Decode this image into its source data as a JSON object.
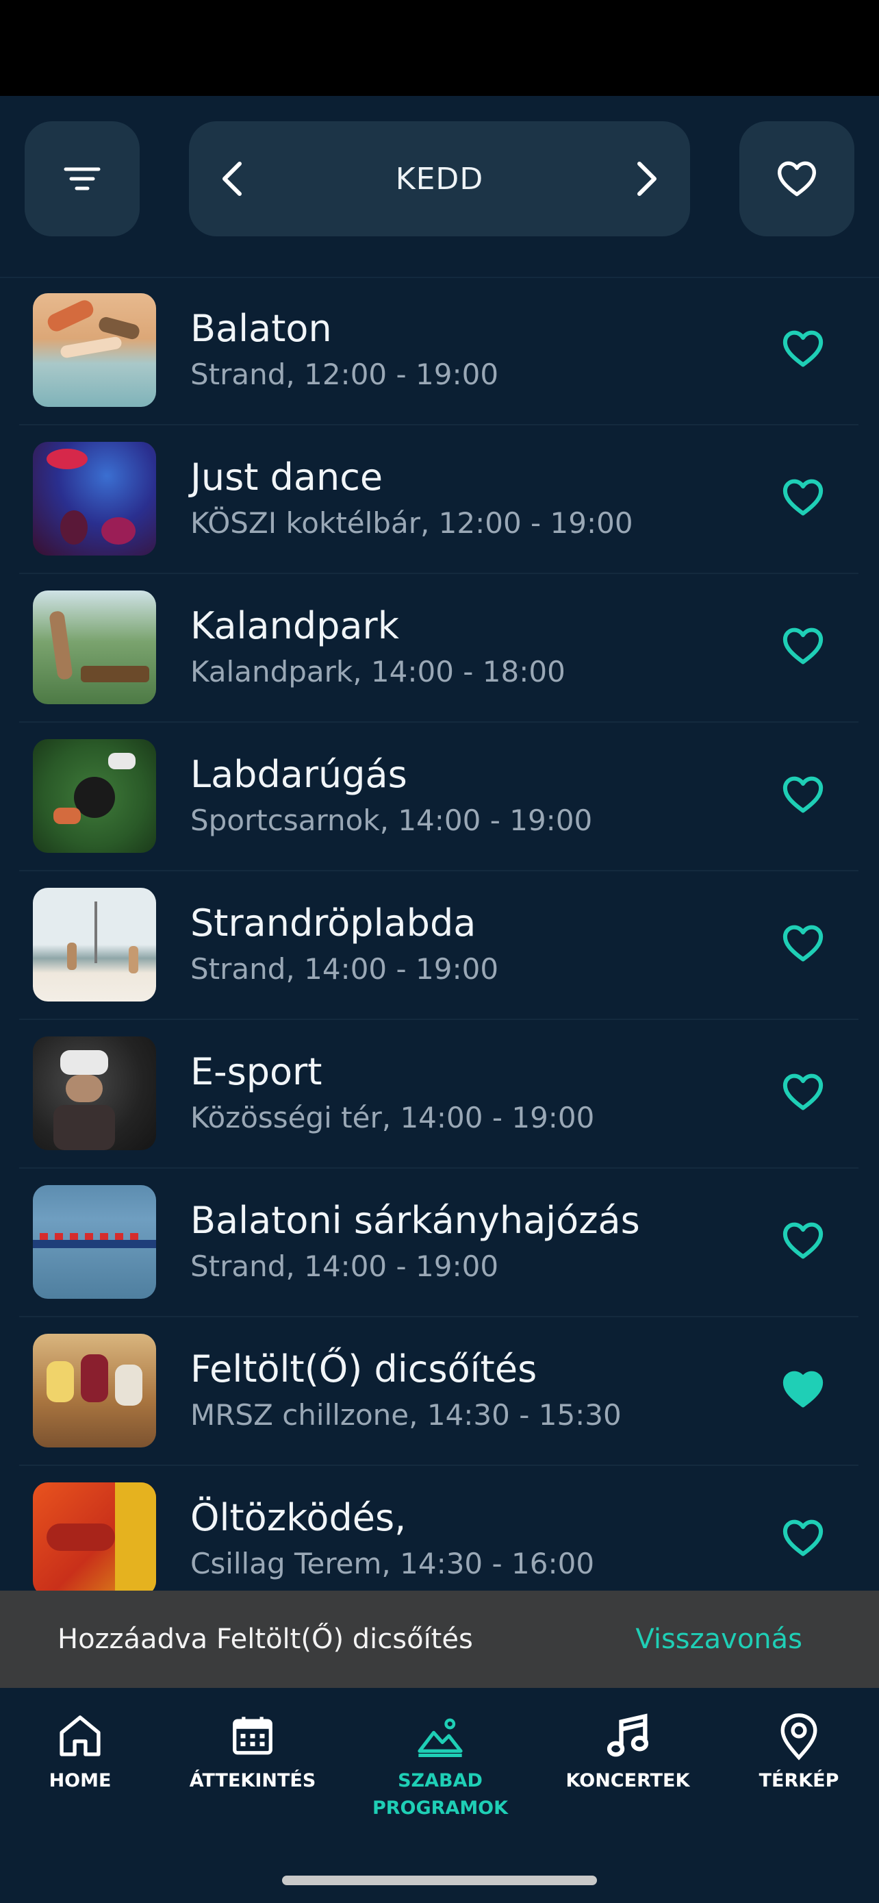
{
  "header": {
    "day": "KEDD",
    "filter_icon": "filter-icon",
    "prev_icon": "chevron-left-icon",
    "next_icon": "chevron-right-icon",
    "favorites_icon": "heart-outline-icon"
  },
  "events": [
    {
      "title": "Balaton",
      "subtitle": "Strand, 12:00 - 19:00",
      "favorite": false
    },
    {
      "title": "Just dance",
      "subtitle": "KÖSZI koktélbár, 12:00 - 19:00",
      "favorite": false
    },
    {
      "title": "Kalandpark",
      "subtitle": "Kalandpark, 14:00 - 18:00",
      "favorite": false
    },
    {
      "title": "Labdarúgás",
      "subtitle": "Sportcsarnok, 14:00 - 19:00",
      "favorite": false
    },
    {
      "title": "Strandröplabda",
      "subtitle": "Strand, 14:00 - 19:00",
      "favorite": false
    },
    {
      "title": "E-sport",
      "subtitle": "Közösségi tér, 14:00 - 19:00",
      "favorite": false
    },
    {
      "title": "Balatoni sárkányhajózás",
      "subtitle": "Strand, 14:00 - 19:00",
      "favorite": false
    },
    {
      "title": "Feltölt(Ő) dicsőítés",
      "subtitle": "MRSZ chillzone, 14:30 - 15:30",
      "favorite": true
    },
    {
      "title": "Öltözködés,",
      "subtitle": "Csillag Terem, 14:30 - 16:00",
      "favorite": false
    }
  ],
  "snackbar": {
    "message": "Hozzáadva Feltölt(Ő) dicsőítés",
    "action": "Visszavonás"
  },
  "tabs": [
    {
      "label": "HOME",
      "icon": "home-icon",
      "active": false
    },
    {
      "label": "ÁTTEKINTÉS",
      "icon": "calendar-icon",
      "active": false
    },
    {
      "label": "SZABAD\nPROGRAMOK",
      "icon": "mountain-icon",
      "active": true
    },
    {
      "label": "KONCERTEK",
      "icon": "music-note-icon",
      "active": false
    },
    {
      "label": "TÉRKÉP",
      "icon": "map-pin-icon",
      "active": false
    }
  ],
  "colors": {
    "background": "#0b1f33",
    "accent": "#1fcfb6",
    "button_bg": "#1c3447",
    "snackbar_bg": "#3b3c3d"
  }
}
